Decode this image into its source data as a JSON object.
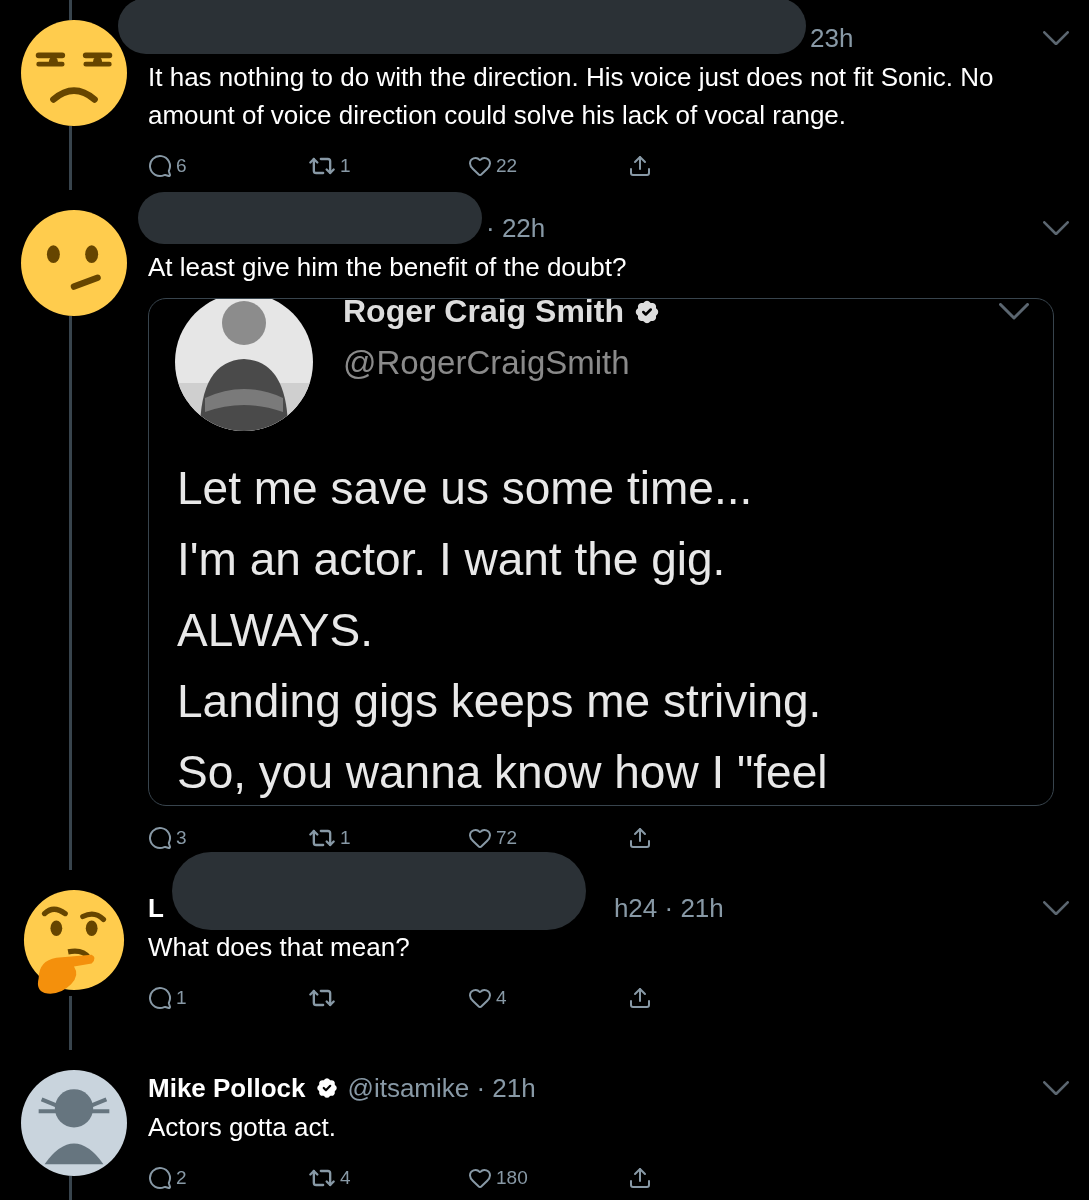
{
  "tweets": [
    {
      "kind": "unamused",
      "redacted": true,
      "meta": "23h",
      "verified": false,
      "text": "It has nothing to do with the direction. His voice just does not fit Sonic. No amount of voice direction could solve his lack of vocal range.",
      "actions": {
        "replies": "6",
        "retweets": "1",
        "likes": "22"
      }
    },
    {
      "kind": "confused",
      "redacted": true,
      "meta": "· 22h",
      "verified": false,
      "text": "At least give him the benefit of the doubt?",
      "quote": {
        "name": "Roger Craig Smith",
        "verified": true,
        "handle": "@RogerCraigSmith",
        "lines": [
          "Let me save us some time...",
          "I'm an actor. I want the gig.",
          "ALWAYS.",
          "Landing gigs keeps me striving.",
          "So, you wanna know how I \"feel"
        ]
      },
      "actions": {
        "replies": "3",
        "retweets": "1",
        "likes": "72"
      }
    },
    {
      "kind": "thinking",
      "redacted": true,
      "name_fragment": "L",
      "meta": "h24 · 21h",
      "verified": false,
      "text": "What does that mean?",
      "actions": {
        "replies": "1",
        "likes": "4"
      }
    },
    {
      "kind": "default",
      "redacted": false,
      "name": "Mike Pollock",
      "verified": true,
      "meta": "@itsamike · 21h",
      "text": "Actors gotta act.",
      "actions": {
        "replies": "2",
        "retweets": "4",
        "likes": "180"
      }
    }
  ]
}
